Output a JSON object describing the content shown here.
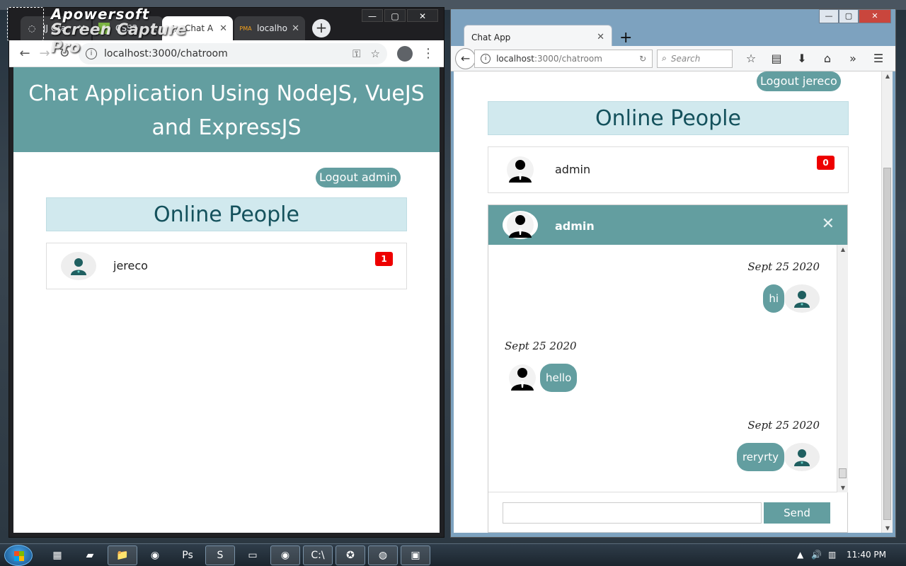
{
  "watermark": {
    "line1": "Apowersoft",
    "line2": "Screen Capture Pro"
  },
  "left_browser": {
    "tabs": [
      {
        "title": "JJ Gra",
        "icon": "loading-icon"
      },
      {
        "title": "CSS3",
        "icon": "css-icon"
      },
      {
        "title": "Chat A",
        "icon": "loading-icon"
      },
      {
        "title": "localho",
        "icon": "phpmyadmin-icon"
      }
    ],
    "url": "localhost:3000/chatroom",
    "page": {
      "header_line1": "Chat Application Using NodeJS, VueJS",
      "header_line2": "and ExpressJS",
      "logout_label": "Logout admin",
      "online_heading": "Online People",
      "users": [
        {
          "name": "jereco",
          "unread": "1"
        }
      ]
    }
  },
  "right_browser": {
    "tab_title": "Chat App",
    "url_host": "localhost",
    "url_path": ":3000/chatroom",
    "search_placeholder": "Search",
    "page": {
      "logout_label": "Logout jereco",
      "online_heading": "Online People",
      "users": [
        {
          "name": "admin",
          "unread": "0"
        }
      ],
      "chat": {
        "partner": "admin",
        "messages": [
          {
            "date": "Sept 25 2020",
            "text": "hi",
            "side": "right"
          },
          {
            "date": "Sept 25 2020",
            "text": "hello",
            "side": "left"
          },
          {
            "date": "Sept 25 2020",
            "text": "reryrty",
            "side": "right"
          }
        ],
        "input_value": "",
        "send_label": "Send"
      }
    }
  },
  "taskbar": {
    "clock": "11:40 PM"
  },
  "colors": {
    "teal": "#639ea0",
    "heading_bg": "#d1e9ee",
    "heading_text": "#14515c",
    "badge_red": "#ee0000"
  }
}
